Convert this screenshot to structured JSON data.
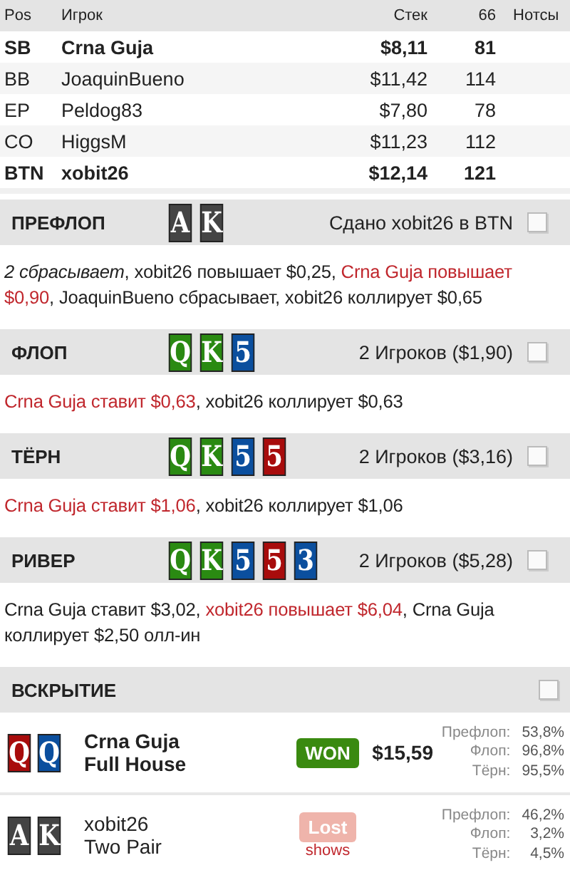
{
  "players_table": {
    "columns": [
      "Pos",
      "Игрок",
      "Стек",
      "66",
      "Нотсы"
    ],
    "rows": [
      {
        "pos": "SB",
        "name": "Crna Guja",
        "stack": "$8,11",
        "col_66": "81",
        "emphasized": true
      },
      {
        "pos": "BB",
        "name": "JoaquinBueno",
        "stack": "$11,42",
        "col_66": "114",
        "emphasized": false
      },
      {
        "pos": "EP",
        "name": "Peldog83",
        "stack": "$7,80",
        "col_66": "78",
        "emphasized": false
      },
      {
        "pos": "CO",
        "name": "HiggsM",
        "stack": "$11,23",
        "col_66": "112",
        "emphasized": false
      },
      {
        "pos": "BTN",
        "name": "xobit26",
        "stack": "$12,14",
        "col_66": "121",
        "emphasized": true
      }
    ]
  },
  "streets": [
    {
      "title": "ПРЕФЛОП",
      "cards": [
        {
          "rank": "A",
          "color": "#444444"
        },
        {
          "rank": "K",
          "color": "#444444"
        }
      ],
      "info": "Сдано xobit26 в BTN",
      "checked": false,
      "actions": [
        {
          "text": "2 сбрасывает",
          "kind": "summary"
        },
        {
          "text": ", xobit26 повышает $0,25, ",
          "kind": "normal"
        },
        {
          "text": "Crna Guja повышает $0,90",
          "kind": "aggressive"
        },
        {
          "text": ", JoaquinBueno сбрасывает, xobit26 коллирует $0,65",
          "kind": "normal"
        }
      ]
    },
    {
      "title": "ФЛОП",
      "cards": [
        {
          "rank": "Q",
          "color": "#2a8a12"
        },
        {
          "rank": "K",
          "color": "#2a8a12"
        },
        {
          "rank": "5",
          "color": "#0b4f9e"
        }
      ],
      "info": "2 Игроков ($1,90)",
      "checked": false,
      "actions": [
        {
          "text": "Crna Guja ставит $0,63",
          "kind": "aggressive"
        },
        {
          "text": ", xobit26 коллирует $0,63",
          "kind": "normal"
        }
      ]
    },
    {
      "title": "ТЁРН",
      "cards": [
        {
          "rank": "Q",
          "color": "#2a8a12"
        },
        {
          "rank": "K",
          "color": "#2a8a12"
        },
        {
          "rank": "5",
          "color": "#0b4f9e"
        },
        {
          "rank": "5",
          "color": "#a80c0c"
        }
      ],
      "info": "2 Игроков ($3,16)",
      "checked": false,
      "actions": [
        {
          "text": "Crna Guja ставит $1,06",
          "kind": "aggressive"
        },
        {
          "text": ", xobit26 коллирует $1,06",
          "kind": "normal"
        }
      ]
    },
    {
      "title": "РИВЕР",
      "cards": [
        {
          "rank": "Q",
          "color": "#2a8a12"
        },
        {
          "rank": "K",
          "color": "#2a8a12"
        },
        {
          "rank": "5",
          "color": "#0b4f9e"
        },
        {
          "rank": "5",
          "color": "#a80c0c"
        },
        {
          "rank": "3",
          "color": "#0b4f9e"
        }
      ],
      "info": "2 Игроков ($5,28)",
      "checked": false,
      "actions": [
        {
          "text": "Crna Guja ставит $3,02, ",
          "kind": "normal"
        },
        {
          "text": "xobit26 повышает $6,04",
          "kind": "aggressive"
        },
        {
          "text": ", Crna Guja коллирует $2,50 олл-ин",
          "kind": "normal"
        }
      ]
    }
  ],
  "showdown": {
    "title": "ВСКРЫТИЕ",
    "checked": false,
    "rows": [
      {
        "cards": [
          {
            "rank": "Q",
            "color": "#a80c0c"
          },
          {
            "rank": "Q",
            "color": "#0b4f9e"
          }
        ],
        "name": "Crna Guja",
        "hand": "Full House",
        "emphasized": true,
        "result": {
          "label": "WON",
          "kind": "won"
        },
        "amount": "$15,59",
        "equities": [
          {
            "street": "Префлоп:",
            "value": "53,8%"
          },
          {
            "street": "Флоп:",
            "value": "96,8%"
          },
          {
            "street": "Тёрн:",
            "value": "95,5%"
          }
        ]
      },
      {
        "cards": [
          {
            "rank": "A",
            "color": "#444444"
          },
          {
            "rank": "K",
            "color": "#444444"
          }
        ],
        "name": "xobit26",
        "hand": "Two Pair",
        "emphasized": false,
        "result": {
          "label": "Lost",
          "kind": "lost"
        },
        "note": "shows",
        "equities": [
          {
            "street": "Префлоп:",
            "value": "46,2%"
          },
          {
            "street": "Флоп:",
            "value": "3,2%"
          },
          {
            "street": "Тёрн:",
            "value": "4,5%"
          }
        ]
      }
    ]
  }
}
